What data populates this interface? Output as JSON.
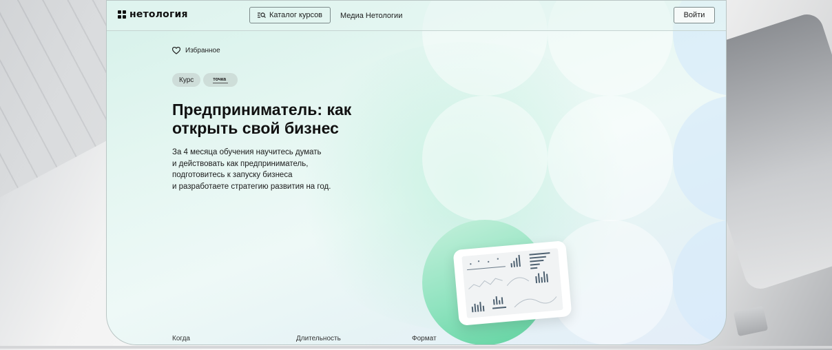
{
  "header": {
    "logo_text": "нетология",
    "catalog_label": "Каталог курсов",
    "media_label": "Медиа Нетологии",
    "login_label": "Войти"
  },
  "hero": {
    "favorites_label": "Избранное",
    "tag_course": "Курс",
    "partner_label": "точка",
    "title_line1": "Предприниматель: как",
    "title_line2": "открыть свой бизнес",
    "description_lines": [
      "За 4 месяца обучения научитесь думать",
      "и действовать как предприниматель,",
      "подготовитесь к запуску бизнеса",
      "и разработаете стратегию развития на год."
    ]
  },
  "info_row": {
    "when_label": "Когда",
    "duration_label": "Длительность",
    "format_label": "Формат"
  },
  "colors": {
    "accent_green": "#5fd29f",
    "card_background": "#e4f6f1",
    "text": "#111111"
  },
  "icons": [
    "logo-mark-icon",
    "catalog-search-icon",
    "heart-icon",
    "dashboard-illustration"
  ]
}
